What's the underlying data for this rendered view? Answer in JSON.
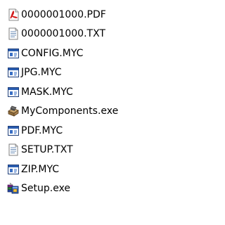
{
  "files": [
    {
      "name": "0000001000.PDF",
      "icon": "pdf-icon"
    },
    {
      "name": "0000001000.TXT",
      "icon": "text-file-icon"
    },
    {
      "name": "CONFIG.MYC",
      "icon": "window-file-icon"
    },
    {
      "name": "JPG.MYC",
      "icon": "window-file-icon"
    },
    {
      "name": "MASK.MYC",
      "icon": "window-file-icon"
    },
    {
      "name": "MyComponents.exe",
      "icon": "installer-box-icon"
    },
    {
      "name": "PDF.MYC",
      "icon": "window-file-icon"
    },
    {
      "name": "SETUP.TXT",
      "icon": "text-file-icon"
    },
    {
      "name": "ZIP.MYC",
      "icon": "window-file-icon"
    },
    {
      "name": "Setup.exe",
      "icon": "setup-package-icon"
    }
  ]
}
